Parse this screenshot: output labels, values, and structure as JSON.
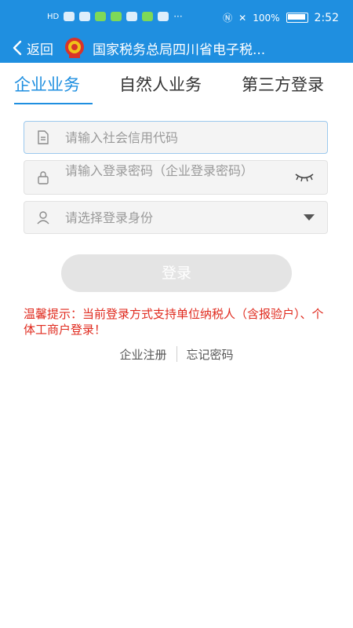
{
  "status_bar": {
    "left_text": "HD",
    "battery": "100%",
    "time": "2:52"
  },
  "header": {
    "back_label": "返回",
    "title": "国家税务总局四川省电子税..."
  },
  "tabs": [
    {
      "label": "企业业务",
      "active": true
    },
    {
      "label": "自然人业务",
      "active": false
    },
    {
      "label": "第三方登录",
      "active": false
    }
  ],
  "form": {
    "credit_code_placeholder": "请输入社会信用代码",
    "password_placeholder": "请输入登录密码（企业登录密码）",
    "identity_placeholder": "请选择登录身份",
    "login_label": "登录"
  },
  "tip": "温馨提示：当前登录方式支持单位纳税人（含报验户）、个体工商户登录！",
  "links": {
    "register": "企业注册",
    "forgot": "忘记密码"
  },
  "colors": {
    "primary": "#1f8fe0",
    "warning": "#e02a1e",
    "disabled_button": "#e4e4e4"
  }
}
